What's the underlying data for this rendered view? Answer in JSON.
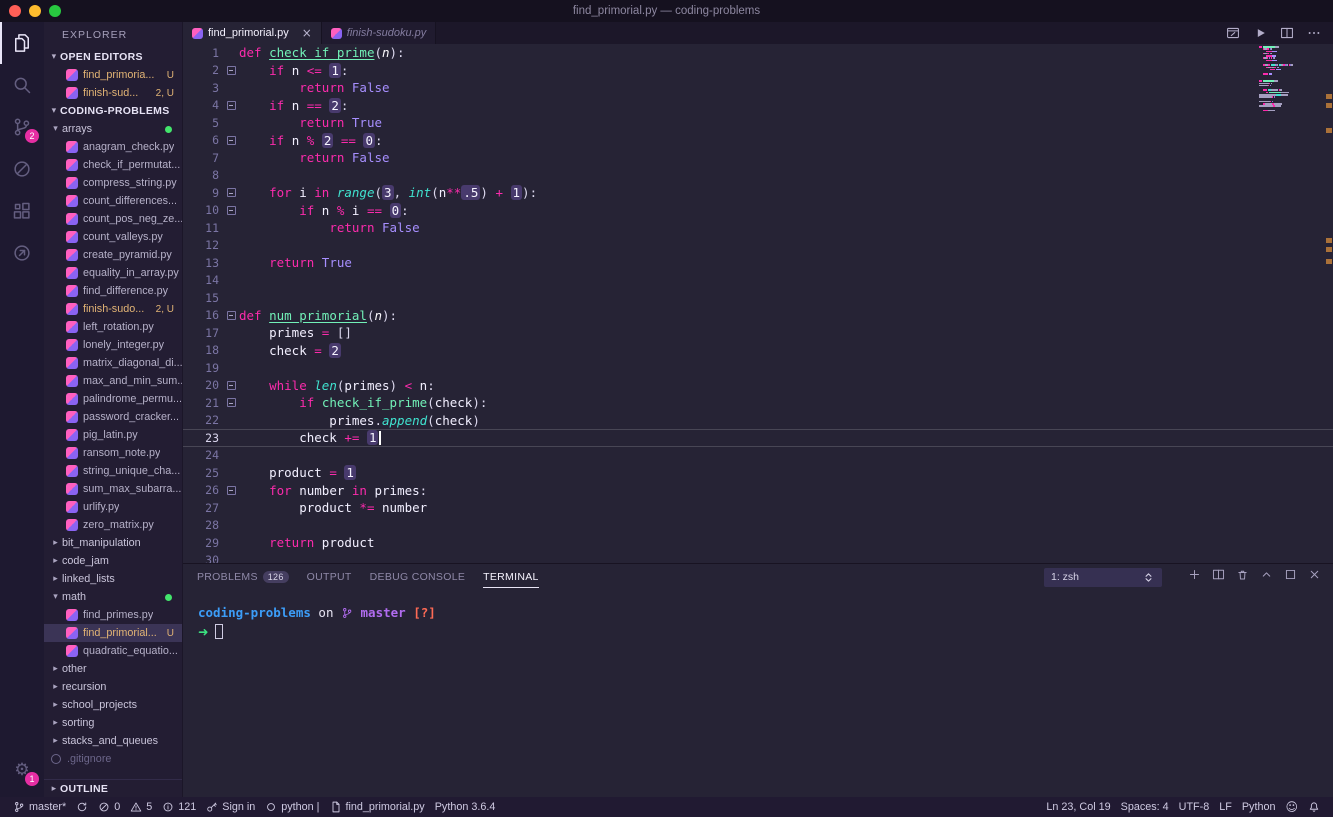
{
  "window": {
    "title": "find_primorial.py — coding-problems"
  },
  "colors": {
    "accent_pink": "#fb2bac",
    "function_green": "#72f1b8",
    "builtin_cyan": "#40e3d0",
    "constant_violet": "#a78fff",
    "number_box_purple": "#483a6d",
    "modified_orange": "#e2b475",
    "badge_pink": "#e62ea3",
    "editor_background": "#262335",
    "sidebar_background": "#231d33",
    "statusbar_background": "#211a32",
    "terminal_dir_blue": "#3c9df8",
    "terminal_branch_purple": "#b16cf0",
    "terminal_prompt_green": "#3be381",
    "terminal_status_red": "#ff6a55"
  },
  "activity_bar": {
    "items": [
      {
        "id": "explorer",
        "icon": "files",
        "active": true
      },
      {
        "id": "search",
        "icon": "search"
      },
      {
        "id": "source-control",
        "icon": "source-control",
        "badge": "2"
      },
      {
        "id": "debug",
        "icon": "debug"
      },
      {
        "id": "extensions",
        "icon": "extensions"
      },
      {
        "id": "live-share",
        "icon": "live-share"
      }
    ],
    "settings": {
      "icon": "gear",
      "badge": "1"
    }
  },
  "sidebar": {
    "title": "EXPLORER",
    "open_editors": {
      "label": "OPEN EDITORS",
      "items": [
        {
          "label": "find_primoria...",
          "suffix": "U",
          "modified": true
        },
        {
          "label": "finish-sud...",
          "suffix": "2, U",
          "modified": true
        }
      ]
    },
    "workspace_label": "CODING-PROBLEMS",
    "outline_label": "OUTLINE",
    "tree": [
      {
        "type": "folder",
        "label": "arrays",
        "expanded": true,
        "dot": true
      },
      {
        "type": "file",
        "label": "anagram_check.py",
        "depth": 1
      },
      {
        "type": "file",
        "label": "check_if_permutat...",
        "depth": 1
      },
      {
        "type": "file",
        "label": "compress_string.py",
        "depth": 1
      },
      {
        "type": "file",
        "label": "count_differences...",
        "depth": 1
      },
      {
        "type": "file",
        "label": "count_pos_neg_ze...",
        "depth": 1
      },
      {
        "type": "file",
        "label": "count_valleys.py",
        "depth": 1
      },
      {
        "type": "file",
        "label": "create_pyramid.py",
        "depth": 1
      },
      {
        "type": "file",
        "label": "equality_in_array.py",
        "depth": 1
      },
      {
        "type": "file",
        "label": "find_difference.py",
        "depth": 1
      },
      {
        "type": "file",
        "label": "finish-sudo...",
        "suffix": "2, U",
        "modified": true,
        "depth": 1
      },
      {
        "type": "file",
        "label": "left_rotation.py",
        "depth": 1
      },
      {
        "type": "file",
        "label": "lonely_integer.py",
        "depth": 1
      },
      {
        "type": "file",
        "label": "matrix_diagonal_di...",
        "depth": 1
      },
      {
        "type": "file",
        "label": "max_and_min_sum...",
        "depth": 1
      },
      {
        "type": "file",
        "label": "palindrome_permu...",
        "depth": 1
      },
      {
        "type": "file",
        "label": "password_cracker...",
        "depth": 1
      },
      {
        "type": "file",
        "label": "pig_latin.py",
        "depth": 1
      },
      {
        "type": "file",
        "label": "ransom_note.py",
        "depth": 1
      },
      {
        "type": "file",
        "label": "string_unique_cha...",
        "depth": 1
      },
      {
        "type": "file",
        "label": "sum_max_subarra...",
        "depth": 1
      },
      {
        "type": "file",
        "label": "urlify.py",
        "depth": 1
      },
      {
        "type": "file",
        "label": "zero_matrix.py",
        "depth": 1
      },
      {
        "type": "folder",
        "label": "bit_manipulation"
      },
      {
        "type": "folder",
        "label": "code_jam"
      },
      {
        "type": "folder",
        "label": "linked_lists"
      },
      {
        "type": "folder",
        "label": "math",
        "expanded": true,
        "dot": true
      },
      {
        "type": "file",
        "label": "find_primes.py",
        "depth": 1
      },
      {
        "type": "file",
        "label": "find_primorial...",
        "suffix": "U",
        "modified": true,
        "selected": true,
        "depth": 1
      },
      {
        "type": "file",
        "label": "quadratic_equatio...",
        "depth": 1
      },
      {
        "type": "folder",
        "label": "other"
      },
      {
        "type": "folder",
        "label": "recursion"
      },
      {
        "type": "folder",
        "label": "school_projects"
      },
      {
        "type": "folder",
        "label": "sorting"
      },
      {
        "type": "folder",
        "label": "stacks_and_queues"
      },
      {
        "type": "file",
        "label": ".gitignore",
        "ignored": true
      }
    ]
  },
  "tab_bar": {
    "tabs": [
      {
        "label": "find_primorial.py",
        "active": true,
        "close": "×"
      },
      {
        "label": "finish-sudoku.py",
        "preview": true
      }
    ],
    "actions": [
      {
        "id": "open-preview",
        "icon": "preview"
      },
      {
        "id": "run-file",
        "icon": "play"
      },
      {
        "id": "split-editor",
        "icon": "split"
      },
      {
        "id": "more-actions",
        "icon": "ellipsis"
      }
    ]
  },
  "editor": {
    "current_line": 23,
    "cursor": {
      "line": 23,
      "col": 19
    },
    "overview_marks": [
      50,
      59,
      84,
      194,
      203,
      215
    ],
    "lines": [
      {
        "n": 1,
        "tokens": [
          [
            "kw",
            "def"
          ],
          [
            "t",
            " "
          ],
          [
            "fn",
            "check_if_prime"
          ],
          [
            "p",
            "("
          ],
          [
            "pr",
            "n"
          ],
          [
            "p",
            "):"
          ]
        ]
      },
      {
        "n": 2,
        "fold": true,
        "tokens": [
          [
            "t",
            "    "
          ],
          [
            "kw",
            "if"
          ],
          [
            "t",
            " n "
          ],
          [
            "op",
            "<="
          ],
          [
            "t",
            " "
          ],
          [
            "num",
            "1"
          ],
          [
            "p",
            ":"
          ]
        ]
      },
      {
        "n": 3,
        "tokens": [
          [
            "t",
            "        "
          ],
          [
            "kw",
            "return"
          ],
          [
            "t",
            " "
          ],
          [
            "cn",
            "False"
          ]
        ]
      },
      {
        "n": 4,
        "fold": true,
        "tokens": [
          [
            "t",
            "    "
          ],
          [
            "kw",
            "if"
          ],
          [
            "t",
            " n "
          ],
          [
            "op",
            "=="
          ],
          [
            "t",
            " "
          ],
          [
            "num",
            "2"
          ],
          [
            "p",
            ":"
          ]
        ]
      },
      {
        "n": 5,
        "tokens": [
          [
            "t",
            "        "
          ],
          [
            "kw",
            "return"
          ],
          [
            "t",
            " "
          ],
          [
            "cn",
            "True"
          ]
        ]
      },
      {
        "n": 6,
        "fold": true,
        "tokens": [
          [
            "t",
            "    "
          ],
          [
            "kw",
            "if"
          ],
          [
            "t",
            " n "
          ],
          [
            "op",
            "%"
          ],
          [
            "t",
            " "
          ],
          [
            "num",
            "2"
          ],
          [
            "t",
            " "
          ],
          [
            "op",
            "=="
          ],
          [
            "t",
            " "
          ],
          [
            "num",
            "0"
          ],
          [
            "p",
            ":"
          ]
        ]
      },
      {
        "n": 7,
        "tokens": [
          [
            "t",
            "        "
          ],
          [
            "kw",
            "return"
          ],
          [
            "t",
            " "
          ],
          [
            "cn",
            "False"
          ]
        ]
      },
      {
        "n": 8,
        "tokens": []
      },
      {
        "n": 9,
        "fold": true,
        "tokens": [
          [
            "t",
            "    "
          ],
          [
            "kw",
            "for"
          ],
          [
            "t",
            " i "
          ],
          [
            "kw",
            "in"
          ],
          [
            "t",
            " "
          ],
          [
            "bi",
            "range"
          ],
          [
            "p",
            "("
          ],
          [
            "num",
            "3"
          ],
          [
            "p",
            ","
          ],
          [
            "t",
            " "
          ],
          [
            "bi",
            "int"
          ],
          [
            "p",
            "("
          ],
          [
            "t",
            "n"
          ],
          [
            "op",
            "**"
          ],
          [
            "num",
            ".5"
          ],
          [
            "p",
            ")"
          ],
          [
            "t",
            " "
          ],
          [
            "op",
            "+"
          ],
          [
            "t",
            " "
          ],
          [
            "num",
            "1"
          ],
          [
            "p",
            "):"
          ]
        ]
      },
      {
        "n": 10,
        "fold": true,
        "tokens": [
          [
            "t",
            "        "
          ],
          [
            "kw",
            "if"
          ],
          [
            "t",
            " n "
          ],
          [
            "op",
            "%"
          ],
          [
            "t",
            " i "
          ],
          [
            "op",
            "=="
          ],
          [
            "t",
            " "
          ],
          [
            "num",
            "0"
          ],
          [
            "p",
            ":"
          ]
        ]
      },
      {
        "n": 11,
        "tokens": [
          [
            "t",
            "            "
          ],
          [
            "kw",
            "return"
          ],
          [
            "t",
            " "
          ],
          [
            "cn",
            "False"
          ]
        ]
      },
      {
        "n": 12,
        "tokens": []
      },
      {
        "n": 13,
        "tokens": [
          [
            "t",
            "    "
          ],
          [
            "kw",
            "return"
          ],
          [
            "t",
            " "
          ],
          [
            "cn",
            "True"
          ]
        ]
      },
      {
        "n": 14,
        "tokens": []
      },
      {
        "n": 15,
        "tokens": []
      },
      {
        "n": 16,
        "fold": true,
        "tokens": [
          [
            "kw",
            "def"
          ],
          [
            "t",
            " "
          ],
          [
            "fn",
            "num_primorial"
          ],
          [
            "p",
            "("
          ],
          [
            "pr",
            "n"
          ],
          [
            "p",
            "):"
          ]
        ]
      },
      {
        "n": 17,
        "tokens": [
          [
            "t",
            "    primes "
          ],
          [
            "op",
            "="
          ],
          [
            "t",
            " "
          ],
          [
            "p",
            "[]"
          ]
        ]
      },
      {
        "n": 18,
        "tokens": [
          [
            "t",
            "    check "
          ],
          [
            "op",
            "="
          ],
          [
            "t",
            " "
          ],
          [
            "num",
            "2"
          ]
        ]
      },
      {
        "n": 19,
        "tokens": []
      },
      {
        "n": 20,
        "fold": true,
        "tokens": [
          [
            "t",
            "    "
          ],
          [
            "kw",
            "while"
          ],
          [
            "t",
            " "
          ],
          [
            "bi",
            "len"
          ],
          [
            "p",
            "("
          ],
          [
            "t",
            "primes"
          ],
          [
            "p",
            ")"
          ],
          [
            "t",
            " "
          ],
          [
            "op",
            "<"
          ],
          [
            "t",
            " n"
          ],
          [
            "p",
            ":"
          ]
        ]
      },
      {
        "n": 21,
        "fold": true,
        "tokens": [
          [
            "t",
            "        "
          ],
          [
            "kw",
            "if"
          ],
          [
            "t",
            " "
          ],
          [
            "fc",
            "check_if_prime"
          ],
          [
            "p",
            "("
          ],
          [
            "t",
            "check"
          ],
          [
            "p",
            "):"
          ]
        ]
      },
      {
        "n": 22,
        "tokens": [
          [
            "t",
            "            primes"
          ],
          [
            "p",
            "."
          ],
          [
            "bi",
            "append"
          ],
          [
            "p",
            "("
          ],
          [
            "t",
            "check"
          ],
          [
            "p",
            ")"
          ]
        ]
      },
      {
        "n": 23,
        "tokens": [
          [
            "t",
            "        check "
          ],
          [
            "op",
            "+="
          ],
          [
            "t",
            " "
          ],
          [
            "num",
            "1"
          ],
          [
            "cur",
            ""
          ]
        ]
      },
      {
        "n": 24,
        "tokens": []
      },
      {
        "n": 25,
        "tokens": [
          [
            "t",
            "    product "
          ],
          [
            "op",
            "="
          ],
          [
            "t",
            " "
          ],
          [
            "num",
            "1"
          ]
        ]
      },
      {
        "n": 26,
        "fold": true,
        "tokens": [
          [
            "t",
            "    "
          ],
          [
            "kw",
            "for"
          ],
          [
            "t",
            " number "
          ],
          [
            "kw",
            "in"
          ],
          [
            "t",
            " primes"
          ],
          [
            "p",
            ":"
          ]
        ]
      },
      {
        "n": 27,
        "tokens": [
          [
            "t",
            "        product "
          ],
          [
            "op",
            "*="
          ],
          [
            "t",
            " number"
          ]
        ]
      },
      {
        "n": 28,
        "tokens": []
      },
      {
        "n": 29,
        "tokens": [
          [
            "t",
            "    "
          ],
          [
            "kw",
            "return"
          ],
          [
            "t",
            " product"
          ]
        ]
      },
      {
        "n": 30,
        "tokens": []
      }
    ]
  },
  "panel": {
    "tabs": [
      {
        "label": "PROBLEMS",
        "badge": "126"
      },
      {
        "label": "OUTPUT"
      },
      {
        "label": "DEBUG CONSOLE"
      },
      {
        "label": "TERMINAL",
        "active": true
      }
    ],
    "shell_select": "1: zsh",
    "actions": [
      {
        "id": "new-terminal",
        "icon": "plus"
      },
      {
        "id": "split-terminal",
        "icon": "split"
      },
      {
        "id": "kill-terminal",
        "icon": "trash"
      },
      {
        "id": "maximize-panel",
        "icon": "chevron-up"
      },
      {
        "id": "restore-panel",
        "icon": "window"
      },
      {
        "id": "close-panel",
        "icon": "close"
      }
    ],
    "terminal": {
      "line1": [
        {
          "cls": "dir",
          "text": "coding-problems"
        },
        {
          "cls": "plain",
          "text": " on "
        },
        {
          "cls": "branch",
          "icon": "git-branch"
        },
        {
          "cls": "branch",
          "text": " master"
        },
        {
          "cls": "plain",
          "text": " "
        },
        {
          "cls": "stat",
          "text": "[?]"
        }
      ],
      "prompt": "➜"
    }
  },
  "status_bar": {
    "left": [
      {
        "id": "git-branch",
        "icon": "git-branch",
        "label": "master*"
      },
      {
        "id": "sync",
        "icon": "sync",
        "label": ""
      },
      {
        "id": "errors",
        "icon": "error",
        "label": "0"
      },
      {
        "id": "warnings",
        "icon": "warning",
        "label": "5"
      },
      {
        "id": "infos",
        "icon": "info",
        "label": "121"
      },
      {
        "id": "sign-in",
        "icon": "key",
        "label": "Sign in"
      },
      {
        "id": "python-env",
        "icon": "python",
        "label": "python |"
      },
      {
        "id": "current-file",
        "icon": "file",
        "label": "find_primorial.py"
      },
      {
        "id": "python-version",
        "label": "Python 3.6.4"
      }
    ],
    "right": [
      {
        "id": "cursor-position",
        "label": "Ln 23, Col 19"
      },
      {
        "id": "indentation",
        "label": "Spaces: 4"
      },
      {
        "id": "encoding",
        "label": "UTF-8"
      },
      {
        "id": "eol",
        "label": "LF"
      },
      {
        "id": "language-mode",
        "label": "Python"
      },
      {
        "id": "feedback",
        "icon": "smiley"
      },
      {
        "id": "notifications",
        "icon": "bell"
      }
    ]
  }
}
